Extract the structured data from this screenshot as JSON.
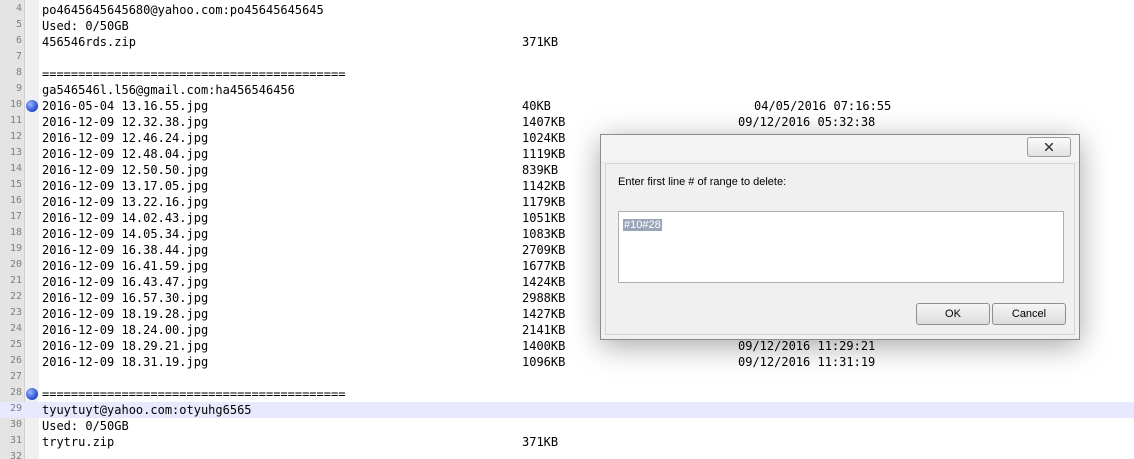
{
  "editor": {
    "lines": [
      {
        "n": "4",
        "text": "po4645645645680@yahoo.com:po45645645645",
        "size": "",
        "date": ""
      },
      {
        "n": "5",
        "text": "Used: 0/50GB",
        "size": "",
        "date": ""
      },
      {
        "n": "6",
        "text": "456546rds.zip",
        "size": "371KB",
        "date": ""
      },
      {
        "n": "7",
        "text": "",
        "size": "",
        "date": ""
      },
      {
        "n": "8",
        "text": "==========================================",
        "size": "",
        "date": ""
      },
      {
        "n": "9",
        "text": "ga546546l.l56@gmail.com:ha456546456",
        "size": "",
        "date": ""
      },
      {
        "n": "10",
        "text": "2016-05-04 13.16.55.jpg",
        "size": "40KB",
        "date": "04/05/2016 07:16:55"
      },
      {
        "n": "11",
        "text": "2016-12-09 12.32.38.jpg",
        "size": "1407KB",
        "date": "09/12/2016 05:32:38"
      },
      {
        "n": "12",
        "text": "2016-12-09 12.46.24.jpg",
        "size": "1024KB",
        "date": ""
      },
      {
        "n": "13",
        "text": "2016-12-09 12.48.04.jpg",
        "size": "1119KB",
        "date": ""
      },
      {
        "n": "14",
        "text": "2016-12-09 12.50.50.jpg",
        "size": "839KB",
        "date": ""
      },
      {
        "n": "15",
        "text": "2016-12-09 13.17.05.jpg",
        "size": "1142KB",
        "date": ""
      },
      {
        "n": "16",
        "text": "2016-12-09 13.22.16.jpg",
        "size": "1179KB",
        "date": ""
      },
      {
        "n": "17",
        "text": "2016-12-09 14.02.43.jpg",
        "size": "1051KB",
        "date": ""
      },
      {
        "n": "18",
        "text": "2016-12-09 14.05.34.jpg",
        "size": "1083KB",
        "date": ""
      },
      {
        "n": "19",
        "text": "2016-12-09 16.38.44.jpg",
        "size": "2709KB",
        "date": ""
      },
      {
        "n": "20",
        "text": "2016-12-09 16.41.59.jpg",
        "size": "1677KB",
        "date": ""
      },
      {
        "n": "21",
        "text": "2016-12-09 16.43.47.jpg",
        "size": "1424KB",
        "date": ""
      },
      {
        "n": "22",
        "text": "2016-12-09 16.57.30.jpg",
        "size": "2988KB",
        "date": ""
      },
      {
        "n": "23",
        "text": "2016-12-09 18.19.28.jpg",
        "size": "1427KB",
        "date": ""
      },
      {
        "n": "24",
        "text": "2016-12-09 18.24.00.jpg",
        "size": "2141KB",
        "date": ""
      },
      {
        "n": "25",
        "text": "2016-12-09 18.29.21.jpg",
        "size": "1400KB",
        "date": "09/12/2016 11:29:21"
      },
      {
        "n": "26",
        "text": "2016-12-09 18.31.19.jpg",
        "size": "1096KB",
        "date": "09/12/2016 11:31:19"
      },
      {
        "n": "27",
        "text": "",
        "size": "",
        "date": ""
      },
      {
        "n": "28",
        "text": "==========================================",
        "size": "",
        "date": ""
      },
      {
        "n": "29",
        "text": "tyuytuyt@yahoo.com:otyuhg6565",
        "size": "",
        "date": ""
      },
      {
        "n": "30",
        "text": "Used: 0/50GB",
        "size": "",
        "date": ""
      },
      {
        "n": "31",
        "text": "trytru.zip",
        "size": "371KB",
        "date": ""
      },
      {
        "n": "32",
        "text": "",
        "size": "",
        "date": ""
      }
    ],
    "bookmarked_lines": [
      "10",
      "28"
    ],
    "highlighted_line": "29",
    "shifted_date_line": "10",
    "colors": {
      "highlight": "#e8e8ff",
      "bookmark": "#3a5fd8",
      "gutter": "#e4e4e4"
    }
  },
  "dialog": {
    "close_icon": "close-icon",
    "prompt": "Enter first line # of range to delete:",
    "input_value": "#10#28",
    "ok_label": "OK",
    "cancel_label": "Cancel"
  }
}
